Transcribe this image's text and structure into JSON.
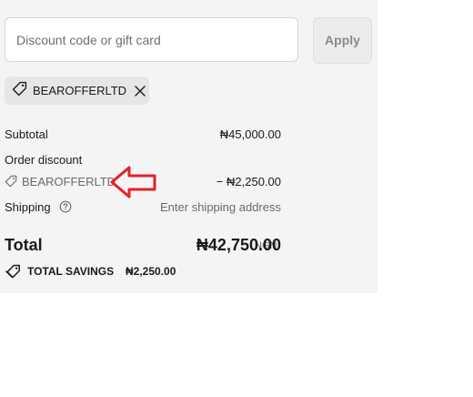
{
  "discount": {
    "placeholder": "Discount code or gift card",
    "apply_label": "Apply"
  },
  "applied_code": {
    "code": "BEAROFFERLTD"
  },
  "summary": {
    "subtotal_label": "Subtotal",
    "subtotal_value": "₦45,000.00",
    "order_discount_label": "Order discount",
    "order_discount_code": "BEAROFFERLTD",
    "order_discount_value": "− ₦2,250.00",
    "shipping_label": "Shipping",
    "shipping_value": "Enter shipping address",
    "total_label": "Total",
    "total_currency": "NGN",
    "total_value": "₦42,750.00",
    "savings_label": "TOTAL SAVINGS",
    "savings_value": "₦2,250.00"
  },
  "colors": {
    "panel_bg": "#f4f4f4",
    "annotation_arrow": "#e3202a"
  }
}
